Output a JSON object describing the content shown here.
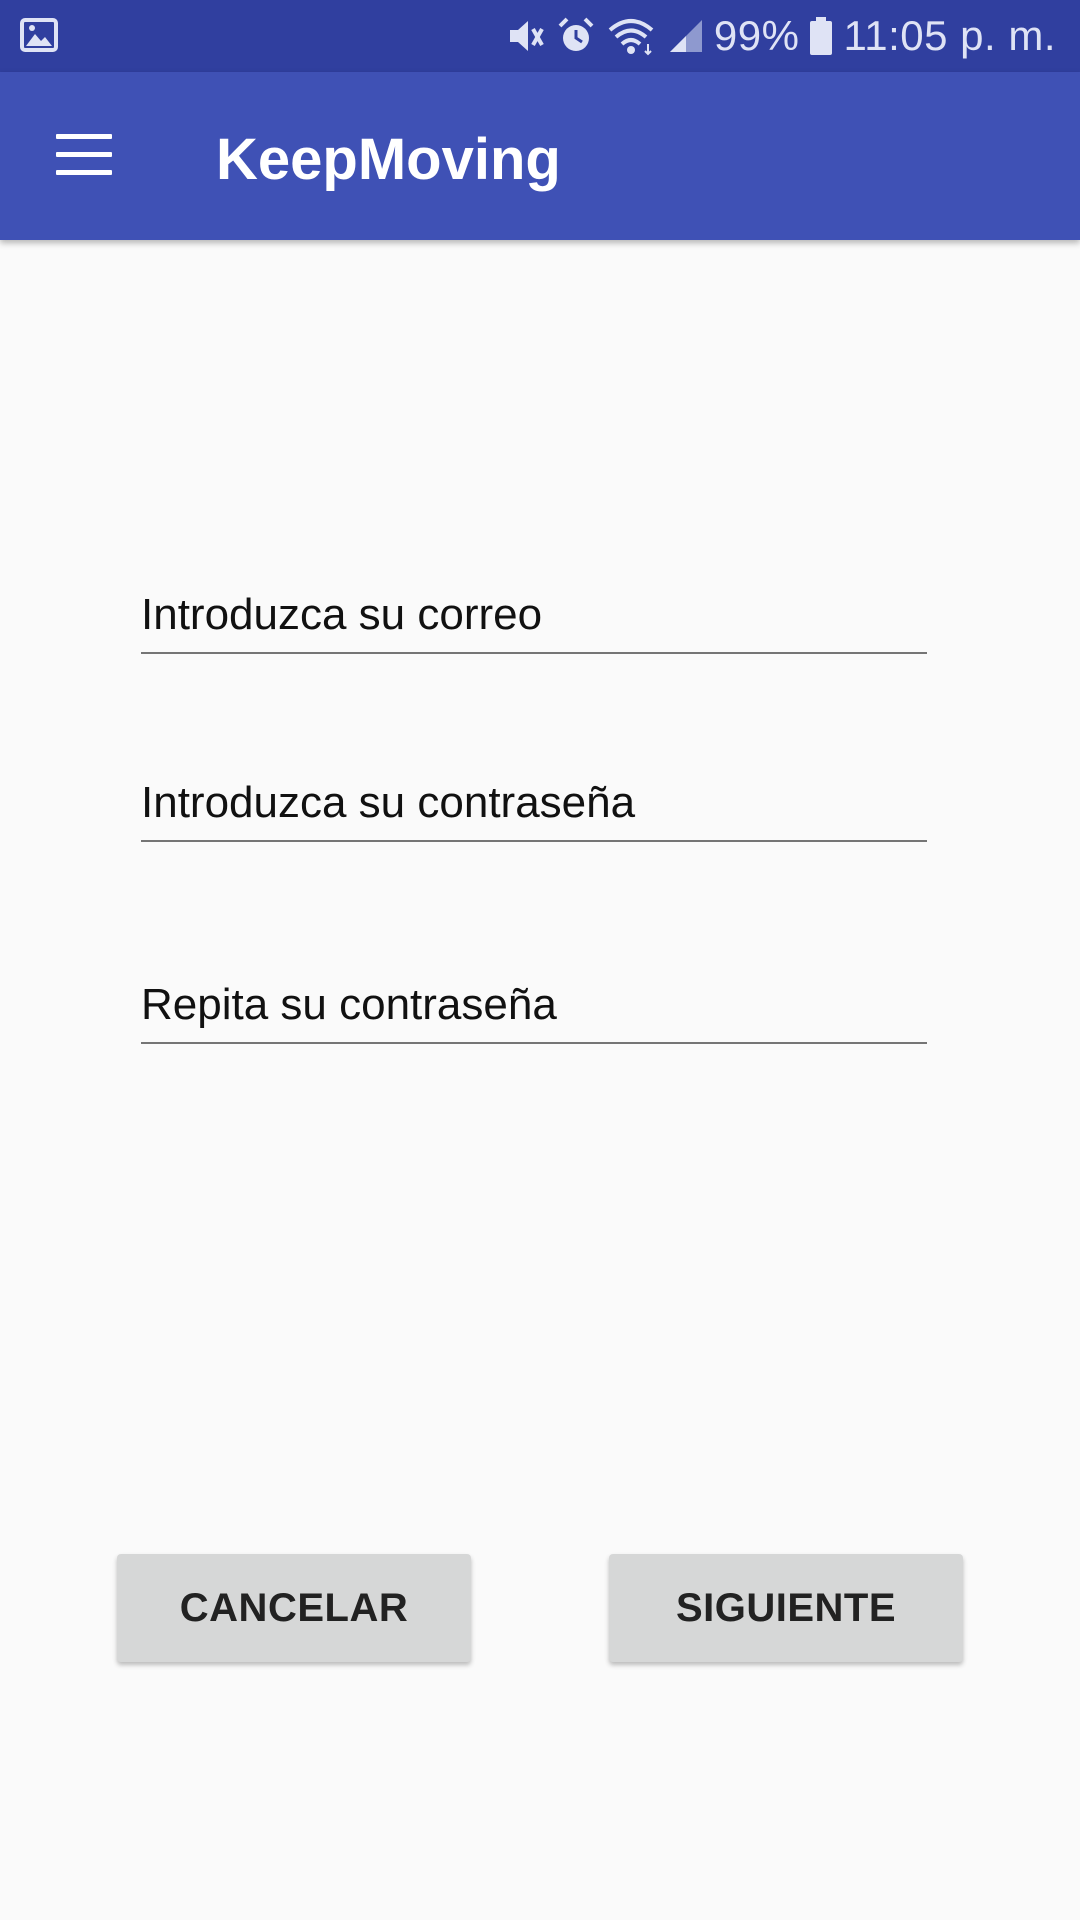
{
  "status_bar": {
    "battery": "99%",
    "time": "11:05 p. m.",
    "icons": [
      "gallery-icon",
      "mute-icon",
      "alarm-icon",
      "wifi-icon",
      "signal-icon",
      "battery-icon"
    ]
  },
  "app_bar": {
    "title": "KeepMoving",
    "menu_icon": "menu-icon"
  },
  "form": {
    "email_placeholder": "Introduzca su correo",
    "password_placeholder": "Introduzca su contraseña",
    "repeat_placeholder": "Repita su contraseña"
  },
  "actions": {
    "cancel_label": "CANCELAR",
    "next_label": "SIGUIENTE"
  },
  "colors": {
    "status_bar": "#303f9f",
    "app_bar": "#3f51b5",
    "background": "#fafafa",
    "button": "#d6d7d7"
  }
}
